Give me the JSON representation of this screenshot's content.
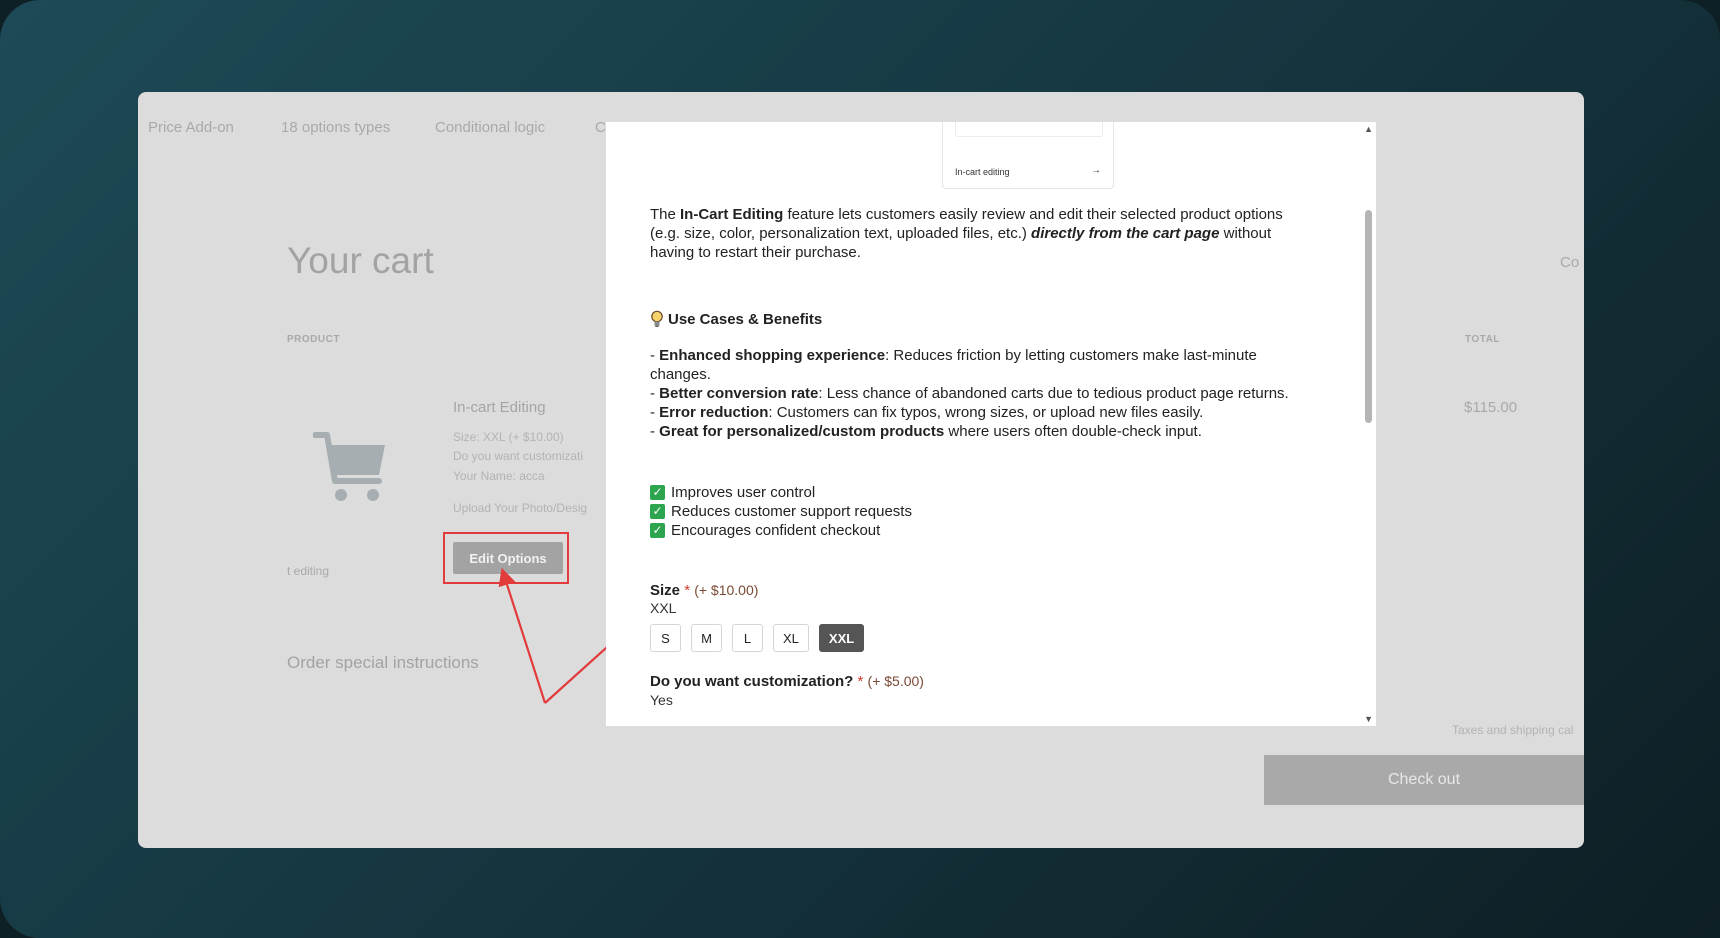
{
  "nav": {
    "items": [
      "Price Add-on",
      "18 options types",
      "Conditional logic",
      "C"
    ]
  },
  "cart": {
    "title": "Your cart",
    "continue_link": "Co",
    "columns": {
      "product": "PRODUCT",
      "total": "TOTAL"
    },
    "item": {
      "name": "In-cart Editing",
      "options": [
        "Size: XXL (+ $10.00)",
        "Do you want customizati",
        "Your Name: acca",
        "Upload Your Photo/Desig"
      ],
      "caption": "t editing",
      "edit_label": "Edit Options",
      "price": "$115.00"
    },
    "instructions_label": "Order special instructions",
    "taxes_note": "Taxes and shipping cal",
    "checkout_label": "Check out"
  },
  "modal": {
    "thumb_label": "In-cart editing",
    "thumb_arrow": "→",
    "intro": {
      "part1": "The ",
      "bold": "In-Cart Editing",
      "part2": " feature lets customers easily review and edit their selected product options (e.g. size, color, personalization text, uploaded files, etc.) ",
      "emph": "directly from the cart page",
      "part3": " without having to restart their purchase."
    },
    "section_title": "Use Cases & Benefits",
    "benefits": [
      {
        "bold": "Enhanced shopping experience",
        "text": ": Reduces friction by letting customers make last-minute changes."
      },
      {
        "bold": "Better conversion rate",
        "text": ": Less chance of abandoned carts due to tedious product page returns."
      },
      {
        "bold": "Error reduction",
        "text": ": Customers can fix typos, wrong sizes, or upload new files easily."
      },
      {
        "bold": "Great for personalized/custom products",
        "text": " where users often double-check input."
      }
    ],
    "checks": [
      "Improves user control",
      "Reduces customer support requests",
      "Encourages confident checkout"
    ],
    "size": {
      "label": "Size",
      "required": "*",
      "addon": "(+ $10.00)",
      "value": "XXL",
      "options": [
        "S",
        "M",
        "L",
        "XL",
        "XXL"
      ],
      "selected": "XXL"
    },
    "customization": {
      "label": "Do you want customization?",
      "required": "*",
      "addon": "(+ $5.00)",
      "value": "Yes"
    }
  },
  "colors": {
    "accent_red": "#e23b3b",
    "check_green": "#2da44e",
    "selected_size": "#555555"
  }
}
